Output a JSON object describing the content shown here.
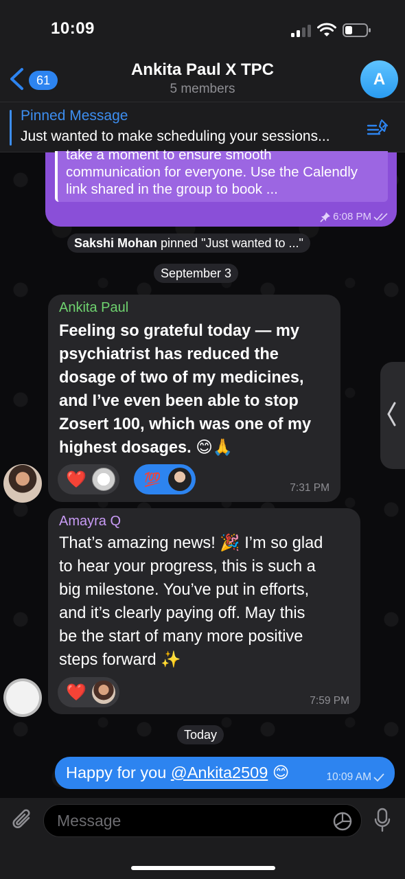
{
  "status_bar": {
    "time": "10:09"
  },
  "header": {
    "back_count": "61",
    "title": "Ankita Paul X TPC",
    "subtitle": "5 members",
    "avatar_letter": "A"
  },
  "pinned": {
    "title": "Pinned Message",
    "text": "Just wanted to make scheduling your sessions..."
  },
  "messages": {
    "outgoing_pinned": {
      "line1": "take a moment to ensure smooth",
      "line2": "communication for everyone. Use the Calendly",
      "line3": "link shared in the group to book ...",
      "time": "6:08 PM"
    },
    "service_pin": {
      "actor": "Sakshi Mohan",
      "text": " pinned \"Just wanted to ...\""
    },
    "date_sep1": "September 3",
    "msg1": {
      "sender": "Ankita Paul",
      "lines": [
        "Feeling so grateful today — my",
        "psychiatrist has reduced the",
        "dosage of two of my medicines,",
        "and I’ve even been able to stop",
        "Zosert 100, which was one of my",
        "highest dosages. 😊🙏"
      ],
      "reaction1": "❤️",
      "reaction2": "💯",
      "time": "7:31 PM"
    },
    "msg2": {
      "sender": "Amayra Q",
      "lines": [
        "That’s amazing news! 🎉 I’m so glad",
        "to hear your progress, this is such a",
        "big milestone. You’ve put in efforts,",
        "and it’s clearly paying off. May this",
        "be the start of many more positive",
        "steps forward ✨"
      ],
      "reaction1": "❤️",
      "time": "7:59 PM"
    },
    "date_sep2": "Today",
    "msg3": {
      "prefix": "Happy for you ",
      "mention": "@Ankita2509",
      "suffix": " 😊",
      "time": "10:09 AM"
    }
  },
  "input": {
    "placeholder": "Message"
  },
  "colors": {
    "accent": "#2d84f0",
    "outgoing_purple": "#8a4fd8",
    "sender_green": "#6fd36f",
    "sender_violet": "#c89bf5"
  }
}
